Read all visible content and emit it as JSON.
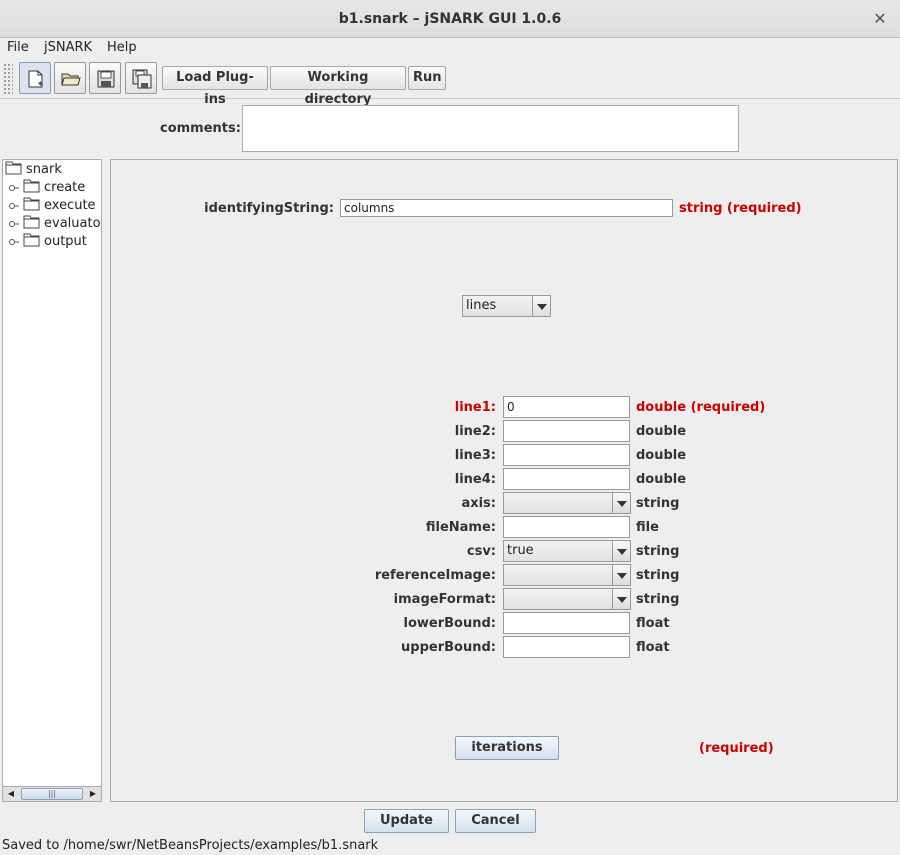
{
  "window": {
    "title": "b1.snark – jSNARK GUI 1.0.6"
  },
  "menu": [
    "File",
    "jSNARK",
    "Help"
  ],
  "toolbar": {
    "icons": [
      "new-file-icon",
      "open-folder-icon",
      "save-icon",
      "save-as-icon"
    ],
    "load_plugins": "Load Plug-ins",
    "working_directory": "Working directory",
    "run": "Run"
  },
  "comments": {
    "label": "comments:",
    "value": ""
  },
  "tree": {
    "root": "snark",
    "children": [
      "create",
      "execute",
      "evaluator",
      "output"
    ]
  },
  "form": {
    "identifying": {
      "label": "identifyingString:",
      "value": "columns",
      "type": "string (required)"
    },
    "selector": {
      "value": "lines"
    },
    "fields": [
      {
        "label": "line1:",
        "value": "0",
        "type": "double (required)",
        "kind": "text",
        "required": true
      },
      {
        "label": "line2:",
        "value": "",
        "type": "double",
        "kind": "text"
      },
      {
        "label": "line3:",
        "value": "",
        "type": "double",
        "kind": "text"
      },
      {
        "label": "line4:",
        "value": "",
        "type": "double",
        "kind": "text"
      },
      {
        "label": "axis:",
        "value": "",
        "type": "string",
        "kind": "combo"
      },
      {
        "label": "fileName:",
        "value": "",
        "type": "file",
        "kind": "text"
      },
      {
        "label": "csv:",
        "value": "true",
        "type": "string",
        "kind": "combo"
      },
      {
        "label": "referenceImage:",
        "value": "",
        "type": "string",
        "kind": "combo"
      },
      {
        "label": "imageFormat:",
        "value": "",
        "type": "string",
        "kind": "combo"
      },
      {
        "label": "lowerBound:",
        "value": "",
        "type": "float",
        "kind": "text"
      },
      {
        "label": "upperBound:",
        "value": "",
        "type": "float",
        "kind": "text"
      }
    ],
    "iterations": {
      "label": "iterations",
      "type": "(required)"
    }
  },
  "actions": {
    "update": "Update",
    "cancel": "Cancel"
  },
  "status": "Saved to /home/swr/NetBeansProjects/examples/b1.snark",
  "colors": {
    "required": "#cc0000"
  }
}
